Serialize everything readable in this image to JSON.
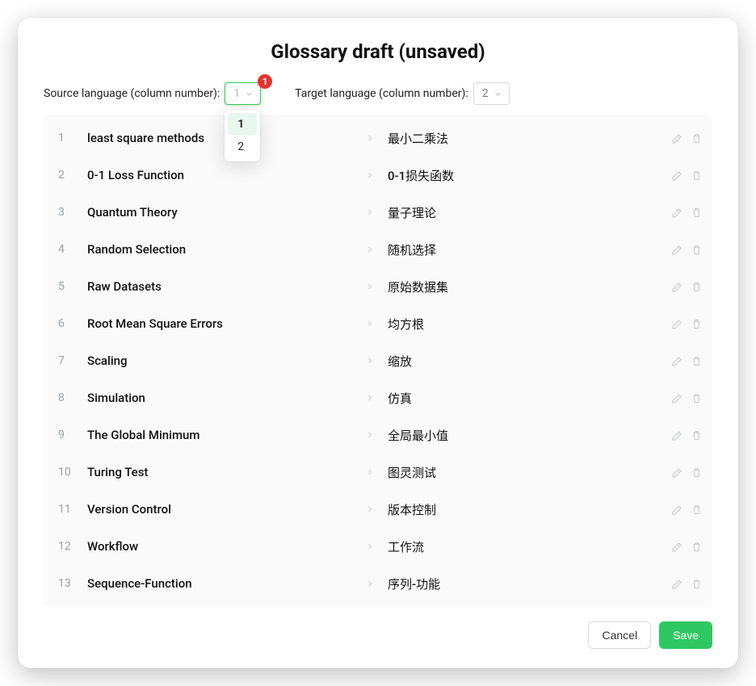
{
  "title": "Glossary draft (unsaved)",
  "sourceLabel": "Source language (column number):",
  "targetLabel": "Target language (column number):",
  "sourceValue": "1",
  "targetValue": "2",
  "badgeCount": "1",
  "dropdownOptions": [
    "1",
    "2"
  ],
  "rows": [
    {
      "n": "1",
      "src": "least square methods",
      "tgt": "最小二乘法"
    },
    {
      "n": "2",
      "src": "0-1 Loss Function",
      "tgt": "0-1损失函数"
    },
    {
      "n": "3",
      "src": "Quantum Theory",
      "tgt": "量子理论"
    },
    {
      "n": "4",
      "src": "Random Selection",
      "tgt": "随机选择"
    },
    {
      "n": "5",
      "src": "Raw Datasets",
      "tgt": "原始数据集"
    },
    {
      "n": "6",
      "src": "Root Mean Square Errors",
      "tgt": "均方根"
    },
    {
      "n": "7",
      "src": "Scaling",
      "tgt": "缩放"
    },
    {
      "n": "8",
      "src": "Simulation",
      "tgt": "仿真"
    },
    {
      "n": "9",
      "src": "The Global Minimum",
      "tgt": "全局最小值"
    },
    {
      "n": "10",
      "src": "Turing Test",
      "tgt": "图灵测试"
    },
    {
      "n": "11",
      "src": "Version Control",
      "tgt": "版本控制"
    },
    {
      "n": "12",
      "src": "Workflow",
      "tgt": "工作流"
    },
    {
      "n": "13",
      "src": "Sequence-Function",
      "tgt": "序列-功能"
    }
  ],
  "buttons": {
    "cancel": "Cancel",
    "save": "Save"
  },
  "colors": {
    "accent": "#34c759",
    "badge": "#e5322e",
    "muted": "#c9ccd1"
  }
}
